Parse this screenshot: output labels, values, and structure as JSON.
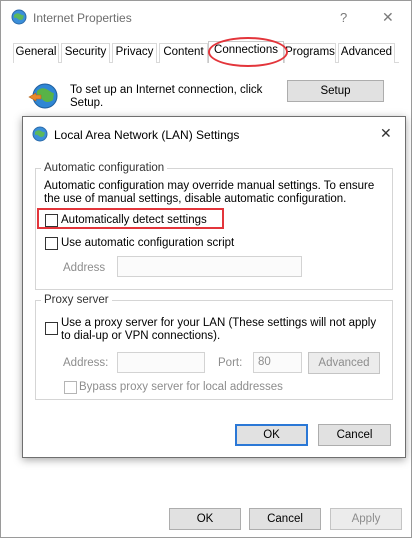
{
  "outer": {
    "title": "Internet Properties",
    "help_glyph": "?",
    "close_glyph": "✕",
    "tabs": [
      {
        "label": "General"
      },
      {
        "label": "Security"
      },
      {
        "label": "Privacy"
      },
      {
        "label": "Content"
      },
      {
        "label": "Connections"
      },
      {
        "label": "Programs"
      },
      {
        "label": "Advanced"
      }
    ],
    "setup_text": "To set up an Internet connection, click Setup.",
    "setup_button": "Setup",
    "ok_button": "OK",
    "cancel_button": "Cancel",
    "apply_button": "Apply"
  },
  "dialog": {
    "title": "Local Area Network (LAN) Settings",
    "close_glyph": "✕",
    "auto_config": {
      "group_label": "Automatic configuration",
      "description": "Automatic configuration may override manual settings.  To ensure the use of manual settings, disable automatic configuration.",
      "detect_label": "Automatically detect settings",
      "script_label": "Use automatic configuration script",
      "address_label": "Address",
      "address_value": ""
    },
    "proxy": {
      "group_label": "Proxy server",
      "use_proxy_label": "Use a proxy server for your LAN (These settings will not apply to dial-up or VPN connections).",
      "address_label": "Address:",
      "address_value": "",
      "port_label": "Port:",
      "port_value": "80",
      "advanced_button": "Advanced",
      "bypass_label": "Bypass proxy server for local addresses"
    },
    "ok_button": "OK",
    "cancel_button": "Cancel"
  },
  "colors": {
    "highlight": "#e3353b",
    "focus_blue": "#2b78d6"
  }
}
